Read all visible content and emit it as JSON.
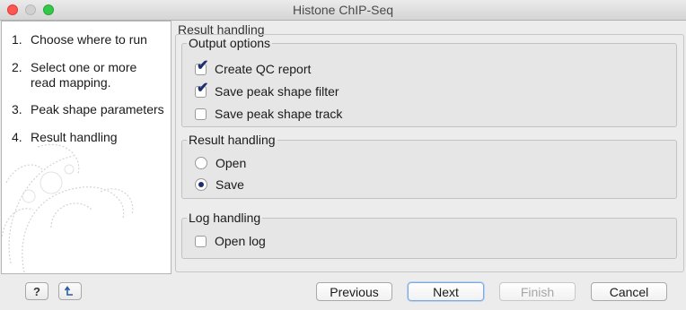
{
  "window": {
    "title": "Histone ChIP-Seq"
  },
  "steps": [
    {
      "num": "1.",
      "label": "Choose where to run"
    },
    {
      "num": "2.",
      "label": "Select one or more read mapping."
    },
    {
      "num": "3.",
      "label": "Peak shape parameters"
    },
    {
      "num": "4.",
      "label": "Result handling"
    }
  ],
  "page": {
    "title": "Result handling"
  },
  "output_options": {
    "legend": "Output options",
    "items": [
      {
        "label": "Create QC report",
        "checked": true
      },
      {
        "label": "Save peak shape filter",
        "checked": true
      },
      {
        "label": "Save peak shape track",
        "checked": false
      }
    ]
  },
  "result_handling": {
    "legend": "Result handling",
    "options": [
      {
        "label": "Open",
        "selected": false
      },
      {
        "label": "Save",
        "selected": true
      }
    ]
  },
  "log_handling": {
    "legend": "Log handling",
    "open_log": {
      "label": "Open log",
      "checked": false
    }
  },
  "buttons": {
    "help": "?",
    "reset_icon": "undo-arrow-icon",
    "previous": "Previous",
    "next": "Next",
    "finish": "Finish",
    "cancel": "Cancel"
  }
}
